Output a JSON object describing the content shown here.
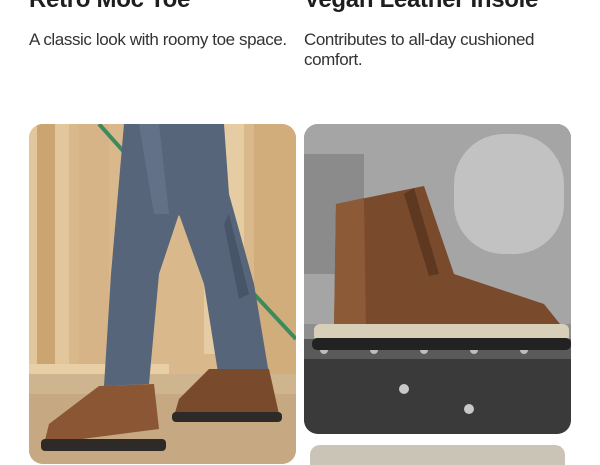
{
  "features": [
    {
      "title": "Retro Moc Toe",
      "description": "A classic look with roomy toe space.",
      "image_icon": "construction-worker-boots-photo"
    },
    {
      "title": "Vegan Leather Insole",
      "description": "Contributes to all-day cushioned comfort.",
      "image_icon": "brown-work-boot-on-steel-beam-photo"
    }
  ],
  "colors": {
    "title": "#1e1e1e",
    "text": "#333333",
    "boot_leather": "#7a4a2c",
    "denim": "#4d5a6e"
  }
}
